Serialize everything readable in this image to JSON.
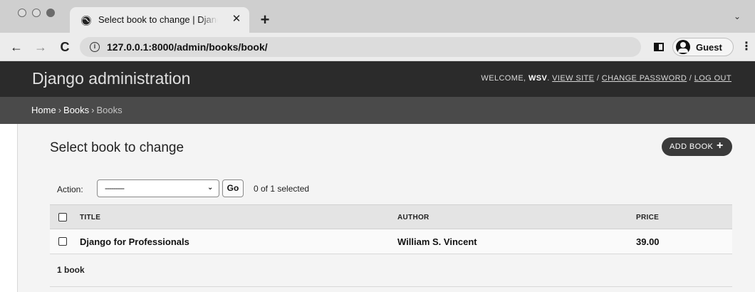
{
  "browser": {
    "tab_title": "Select book to change | Django site admin",
    "url": "127.0.0.1:8000/admin/books/book/",
    "profile_name": "Guest"
  },
  "header": {
    "brand": "Django administration",
    "welcome": "WELCOME,",
    "username": "WSV",
    "view_site": "VIEW SITE",
    "change_password": "CHANGE PASSWORD",
    "log_out": "LOG OUT",
    "separator": "/"
  },
  "breadcrumbs": {
    "home": "Home",
    "app": "Books",
    "current": "Books",
    "separator": "›"
  },
  "main": {
    "title": "Select book to change",
    "add_button": "ADD BOOK",
    "actions": {
      "label": "Action:",
      "selected_value": "---------",
      "go_label": "Go",
      "selected_count": "0 of 1 selected"
    },
    "table": {
      "columns": [
        "TITLE",
        "AUTHOR",
        "PRICE"
      ],
      "rows": [
        {
          "title": "Django for Professionals",
          "author": "William S. Vincent",
          "price": "39.00"
        }
      ]
    },
    "paginator": "1 book"
  },
  "colors": {
    "header_bg": "#2b2b2b",
    "breadcrumb_bg": "#4a4a4a",
    "button_bg": "#3a3a3a"
  }
}
